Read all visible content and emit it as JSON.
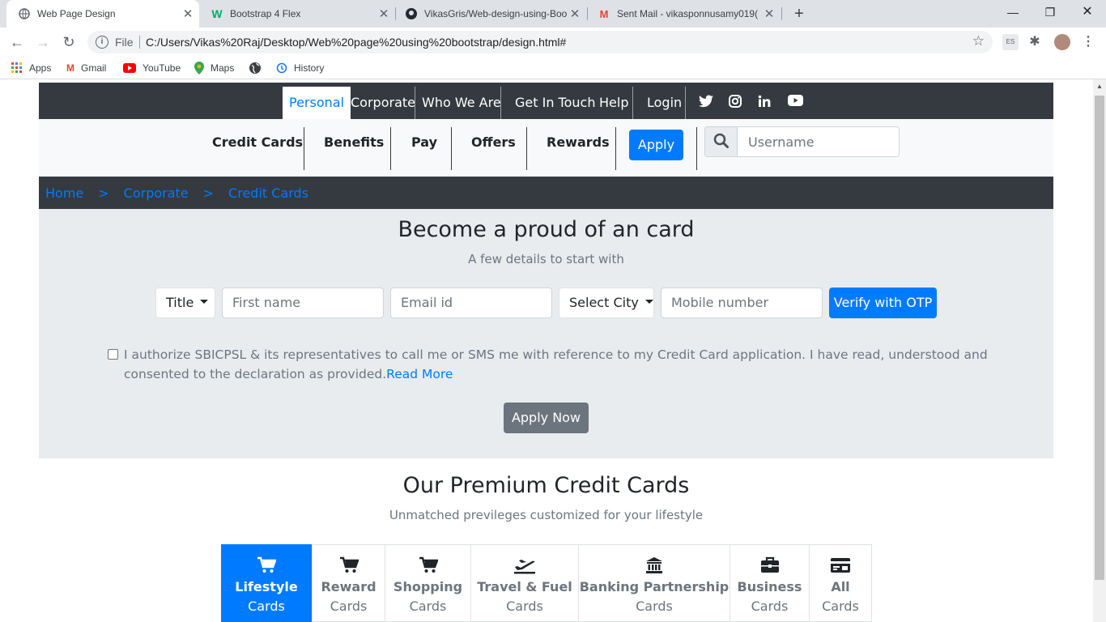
{
  "browser": {
    "tabs": [
      {
        "title": "Web Page Design",
        "active": true
      },
      {
        "title": "Bootstrap 4 Flex",
        "active": false
      },
      {
        "title": "VikasGris/Web-design-using-Boo",
        "active": false
      },
      {
        "title": "Sent Mail - vikasponnusamy019(",
        "active": false
      }
    ],
    "omnibox": {
      "scheme": "File",
      "url": "C:/Users/Vikas%20Raj/Desktop/Web%20page%20using%20bootstrap/design.html#"
    },
    "bookmarks": [
      "Apps",
      "Gmail",
      "YouTube",
      "Maps",
      "",
      "History"
    ]
  },
  "topnav": {
    "items": [
      "Personal",
      "Corporate",
      "Who We Are",
      "Get In Touch",
      "Help",
      "Login"
    ],
    "active": "Personal",
    "social": [
      "twitter-icon",
      "instagram-icon",
      "linkedin-icon",
      "youtube-icon"
    ]
  },
  "subnav": {
    "items": [
      "Credit Cards",
      "Benefits",
      "Pay",
      "Offers",
      "Rewards"
    ],
    "apply_label": "Apply",
    "search_placeholder": "Username"
  },
  "breadcrumb": [
    "Home",
    ">",
    "Corporate",
    ">",
    "Credit Cards"
  ],
  "form": {
    "title": "Become a proud of an card",
    "lead": "A few details to start with",
    "title_select": "Title",
    "first_name_placeholder": "First name",
    "email_placeholder": "Email id",
    "city_select": "Select City",
    "mobile_placeholder": "Mobile number",
    "otp_label": "Verify with OTP",
    "consent_text": "I authorize SBICPSL & its representatives to call me or SMS me with reference to my Credit Card application. I have read, understood and consented to the declaration as provided.",
    "read_more": "Read More",
    "apply_now": "Apply Now"
  },
  "premium": {
    "title": "Our Premium Credit Cards",
    "subtitle": "Unmatched previleges customized for your lifestyle",
    "tabs": [
      {
        "name": "Lifestyle",
        "suffix": "Cards",
        "icon": "cart-icon",
        "active": true
      },
      {
        "name": "Reward",
        "suffix": "Cards",
        "icon": "cart-icon",
        "active": false
      },
      {
        "name": "Shopping",
        "suffix": "Cards",
        "icon": "cart-icon",
        "active": false
      },
      {
        "name": "Travel & Fuel",
        "suffix": "Cards",
        "icon": "plane-icon",
        "active": false
      },
      {
        "name": "Banking Partnership",
        "suffix": "Cards",
        "icon": "bank-icon",
        "active": false
      },
      {
        "name": "Business",
        "suffix": "Cards",
        "icon": "briefcase-icon",
        "active": false
      },
      {
        "name": "All",
        "suffix": "Cards",
        "icon": "credit-card-icon",
        "active": false
      }
    ]
  },
  "colors": {
    "primary": "#007bff",
    "dark": "#343a40",
    "secondary": "#6c757d",
    "light": "#e9ecef"
  }
}
